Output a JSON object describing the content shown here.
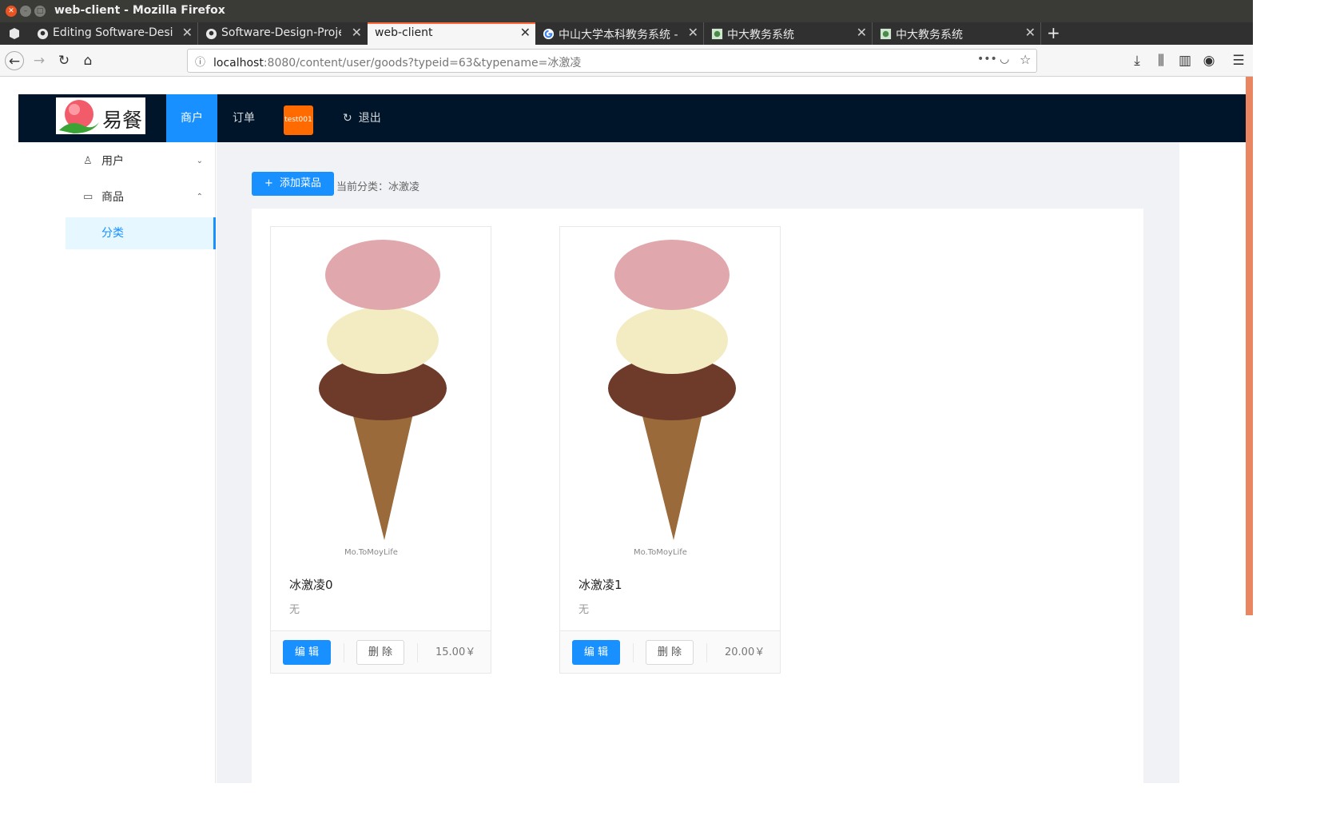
{
  "window": {
    "title": "web-client - Mozilla Firefox"
  },
  "tabs": [
    {
      "label": "Editing Software-Design",
      "icon": "github-icon"
    },
    {
      "label": "Software-Design-Projec",
      "icon": "github-icon"
    },
    {
      "label": "web-client",
      "icon": "none",
      "active": true
    },
    {
      "label": "中山大学本科教务系统 - (",
      "icon": "google-icon"
    },
    {
      "label": "中大教务系统",
      "icon": "sysu-icon"
    },
    {
      "label": "中大教务系统",
      "icon": "sysu-icon"
    }
  ],
  "urlbar": {
    "host": "localhost",
    "path": ":8080/content/user/goods?typeid=63&typename=冰激凌"
  },
  "header": {
    "logo_text": "易餐",
    "nav": {
      "merchant": "商户",
      "orders": "订单",
      "logout": "退出"
    },
    "user": "test001"
  },
  "sidebar": {
    "user": "用户",
    "goods": "商品",
    "category": "分类"
  },
  "content": {
    "add_label": "添加菜品",
    "current_category": "当前分类：冰激凌"
  },
  "goods": [
    {
      "name": "冰激凌0",
      "desc": "无",
      "price": "15.00￥",
      "edit": "编 辑",
      "delete": "删 除"
    },
    {
      "name": "冰激凌1",
      "desc": "无",
      "price": "20.00￥",
      "edit": "编 辑",
      "delete": "删 除"
    }
  ],
  "colors": {
    "accent": "#1890ff",
    "header_bg": "#001529",
    "badge": "#ff6b00",
    "tab_highlight": "#ff6a3d"
  }
}
